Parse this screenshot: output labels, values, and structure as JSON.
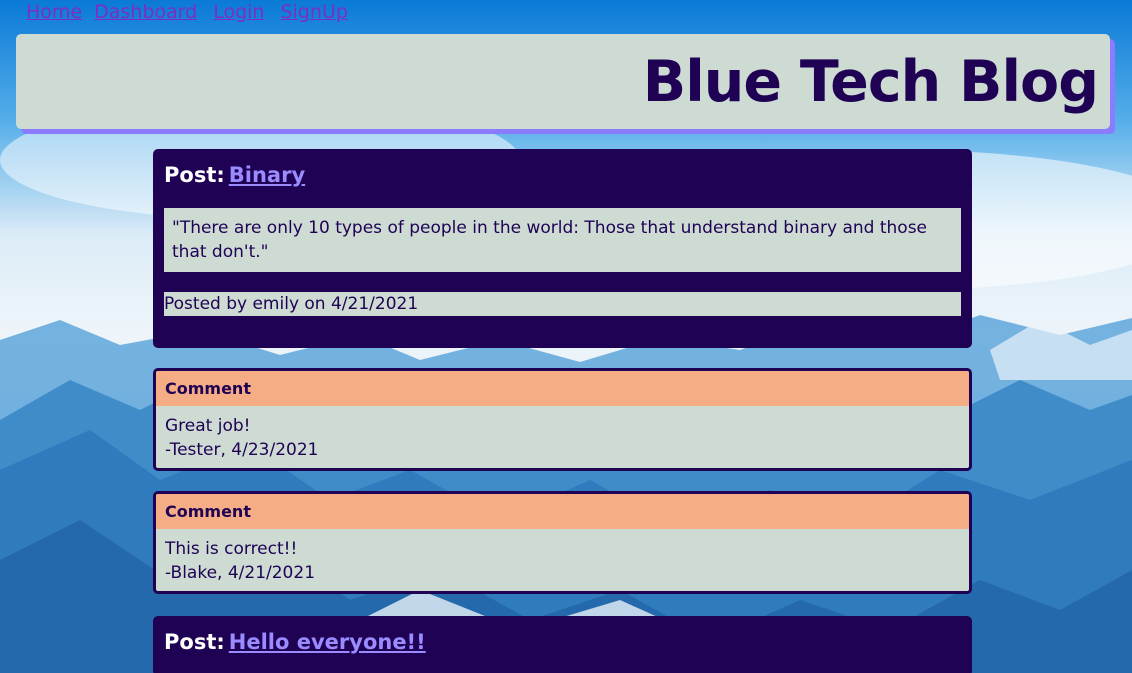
{
  "nav": {
    "home": "Home",
    "dashboard": "Dashboard",
    "login": "Login",
    "signup": "SignUp"
  },
  "header": {
    "title": "Blue Tech Blog"
  },
  "posts": [
    {
      "label": "Post:",
      "title": "Binary",
      "body": "\"There are only 10 types of people in the world: Those that understand binary and those that don't.\"",
      "meta": "Posted by emily on 4/21/2021",
      "comments": [
        {
          "label": "Comment",
          "text": "Great job!",
          "byline": "-Tester, 4/23/2021"
        },
        {
          "label": "Comment",
          "text": "This is correct!!",
          "byline": "-Blake, 4/21/2021"
        }
      ]
    },
    {
      "label": "Post:",
      "title": "Hello everyone!!"
    }
  ],
  "colors": {
    "navy": "#1f0254",
    "panel": "#cddbd3",
    "comment_header": "#f5ad85",
    "link": "#9a8cff",
    "nav_link": "#7c2ec4",
    "header_shadow": "#8a7bff"
  }
}
